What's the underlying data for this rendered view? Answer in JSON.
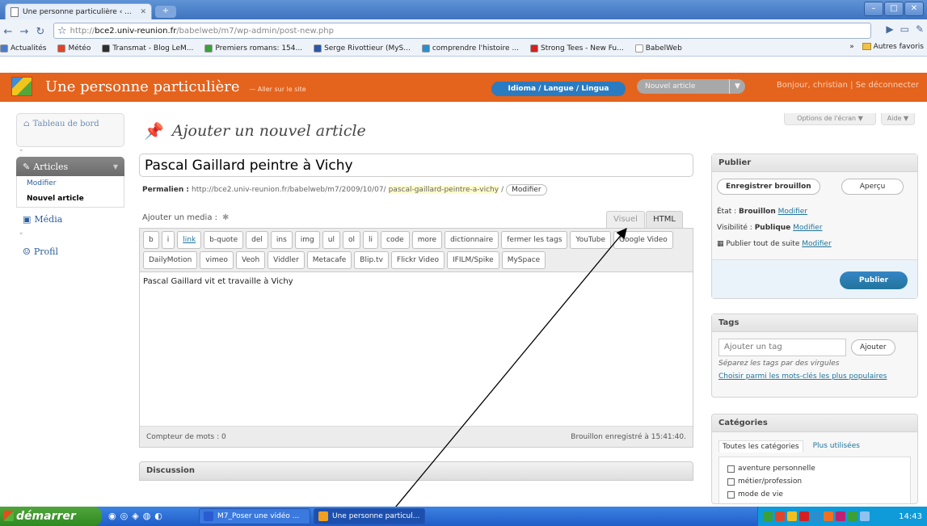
{
  "browser": {
    "tab_title": "Une personne particulière ‹ ...",
    "url_prefix": "http://",
    "url_domain": "bce2.univ-reunion.fr",
    "url_path": "/babelweb/m7/wp-admin/post-new.php",
    "bookmarks": [
      {
        "label": "Actualités",
        "color": "#4a7bd0"
      },
      {
        "label": "Météo",
        "color": "#e0442a"
      },
      {
        "label": "Transmat - Blog LeM...",
        "color": "#2e2e2e"
      },
      {
        "label": "Premiers romans: 154...",
        "color": "#3aa03a"
      },
      {
        "label": "Serge Rivottieur (MyS...",
        "color": "#2c56a8"
      },
      {
        "label": "comprendre l'histoire ...",
        "color": "#2c8ecf"
      },
      {
        "label": "Strong Tees - New Fu...",
        "color": "#d62020"
      },
      {
        "label": "BabelWeb",
        "color": "#ffffff"
      }
    ],
    "bookmarks_overflow": "»",
    "other_bookmarks": "Autres favoris"
  },
  "header": {
    "blog_name": "Une personne particulière",
    "visit_site": "Aller sur le site",
    "lang_button": "Idioma / Langue / Lingua",
    "new_article_button": "Nouvel article",
    "greeting": "Bonjour, christian | Se déconnecter"
  },
  "menu": {
    "dashboard": "Tableau de bord",
    "articles": "Articles",
    "articles_sub": [
      "Modifier",
      "Nouvel article"
    ],
    "media": "Média",
    "profile": "Profil"
  },
  "screen_options": "Options de l'écran",
  "help": "Aide",
  "page_title": "Ajouter un nouvel article",
  "post": {
    "title": "Pascal Gaillard peintre à Vichy",
    "permalink_label": "Permalien :",
    "permalink_base": "http://bce2.univ-reunion.fr/babelweb/m7/2009/10/07/",
    "permalink_slug": "pascal-gaillard-peintre-a-vichy",
    "permalink_end": "/",
    "permalink_edit": "Modifier",
    "add_media": "Ajouter un media :",
    "tab_visual": "Visuel",
    "tab_html": "HTML",
    "quicktags_row1": [
      "b",
      "i",
      "link",
      "b-quote",
      "del",
      "ins",
      "img",
      "ul",
      "ol",
      "li",
      "code",
      "more",
      "dictionnaire",
      "fermer les tags",
      "YouTube"
    ],
    "quicktags_row2": [
      "Google Video",
      "DailyMotion",
      "vimeo",
      "Veoh",
      "Viddler",
      "Metacafe",
      "Blip.tv",
      "Flickr Video",
      "IFILM/Spike",
      "MySpace"
    ],
    "content": "Pascal Gaillard vit et travaille à Vichy",
    "word_count": "Compteur de mots : 0",
    "draft_saved": "Brouillon enregistré à 15:41:40."
  },
  "discussion": "Discussion",
  "publish_box": {
    "heading": "Publier",
    "save_draft": "Enregistrer brouillon",
    "preview": "Aperçu",
    "status_label": "État :",
    "status_value": "Brouillon",
    "status_edit": "Modifier",
    "visibility_label": "Visibilité :",
    "visibility_value": "Publique",
    "visibility_edit": "Modifier",
    "publish_time": "Publier tout de suite",
    "publish_time_edit": "Modifier",
    "publish_button": "Publier"
  },
  "tags_box": {
    "heading": "Tags",
    "input_placeholder": "Ajouter un tag",
    "add_button": "Ajouter",
    "hint": "Séparez les tags par des virgules",
    "popular": "Choisir parmi les mots-clés les plus populaires"
  },
  "categories_box": {
    "heading": "Catégories",
    "tab_all": "Toutes les catégories",
    "tab_popular": "Plus utilisées",
    "items": [
      "aventure personnelle",
      "métier/profession",
      "mode de vie"
    ]
  },
  "taskbar": {
    "start": "démarrer",
    "tasks": [
      "M7_Poser une vidéo ...",
      "Une personne particul..."
    ],
    "clock": "14:43"
  }
}
